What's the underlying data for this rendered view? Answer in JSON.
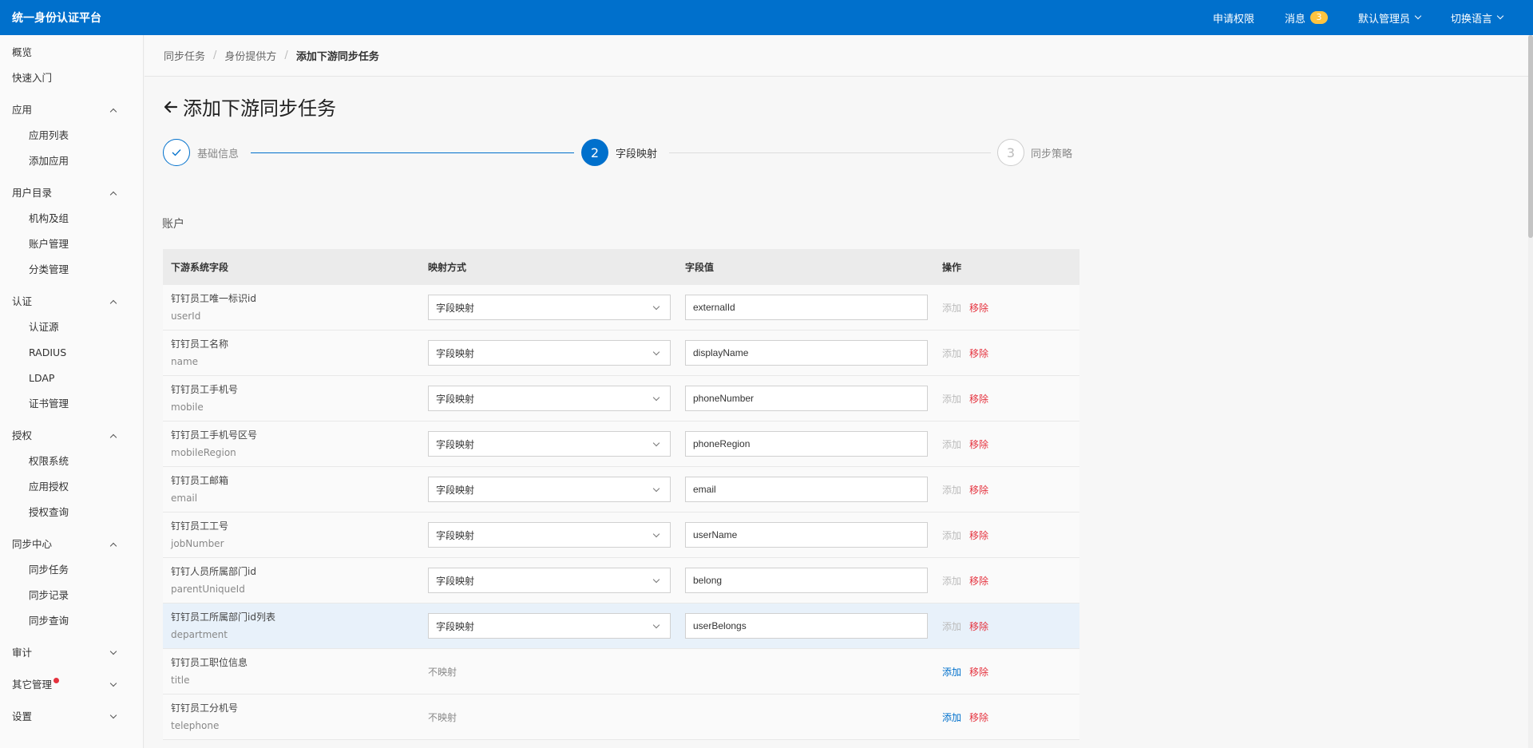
{
  "app": {
    "title": "统一身份认证平台"
  },
  "topbar": {
    "request_permission": "申请权限",
    "messages": "消息",
    "message_count": "3",
    "user": "默认管理员",
    "language": "切换语言"
  },
  "sidebar": {
    "overview": "概览",
    "quick_start": "快速入门",
    "app_group": "应用",
    "app_list": "应用列表",
    "add_app": "添加应用",
    "directory_group": "用户目录",
    "org_group": "机构及组",
    "account_mgmt": "账户管理",
    "category_mgmt": "分类管理",
    "auth_group": "认证",
    "auth_source": "认证源",
    "radius": "RADIUS",
    "ldap": "LDAP",
    "cert_mgmt": "证书管理",
    "authz_group": "授权",
    "perm_system": "权限系统",
    "app_authz": "应用授权",
    "authz_query": "授权查询",
    "sync_group": "同步中心",
    "sync_task": "同步任务",
    "sync_record": "同步记录",
    "sync_query": "同步查询",
    "audit": "审计",
    "other_mgmt": "其它管理",
    "settings": "设置"
  },
  "breadcrumb": {
    "level1": "同步任务",
    "level2": "身份提供方",
    "current": "添加下游同步任务",
    "separator": "/"
  },
  "page": {
    "title": "添加下游同步任务"
  },
  "steps": {
    "step1_label": "基础信息",
    "step2_number": "2",
    "step2_label": "字段映射",
    "step3_number": "3",
    "step3_label": "同步策略"
  },
  "section": {
    "title": "账户"
  },
  "table": {
    "headers": {
      "field": "下游系统字段",
      "mapping": "映射方式",
      "value": "字段值",
      "actions": "操作"
    },
    "add_label": "添加",
    "remove_label": "移除",
    "rows": [
      {
        "cn": "钉钉员工唯一标识id",
        "en": "userId",
        "mapping": "字段映射",
        "value": "externalId"
      },
      {
        "cn": "钉钉员工名称",
        "en": "name",
        "mapping": "字段映射",
        "value": "displayName"
      },
      {
        "cn": "钉钉员工手机号",
        "en": "mobile",
        "mapping": "字段映射",
        "value": "phoneNumber"
      },
      {
        "cn": "钉钉员工手机号区号",
        "en": "mobileRegion",
        "mapping": "字段映射",
        "value": "phoneRegion"
      },
      {
        "cn": "钉钉员工邮箱",
        "en": "email",
        "mapping": "字段映射",
        "value": "email"
      },
      {
        "cn": "钉钉员工工号",
        "en": "jobNumber",
        "mapping": "字段映射",
        "value": "userName"
      },
      {
        "cn": "钉钉人员所属部门id",
        "en": "parentUniqueId",
        "mapping": "字段映射",
        "value": "belong"
      },
      {
        "cn": "钉钉员工所属部门id列表",
        "en": "department",
        "mapping": "字段映射",
        "value": "userBelongs"
      },
      {
        "cn": "钉钉员工职位信息",
        "en": "title",
        "mapping": "不映射",
        "value": ""
      },
      {
        "cn": "钉钉员工分机号",
        "en": "telephone",
        "mapping": "不映射",
        "value": ""
      }
    ]
  },
  "colors": {
    "primary": "#0070cc",
    "danger": "#e5323e",
    "badge": "#ffc440"
  }
}
